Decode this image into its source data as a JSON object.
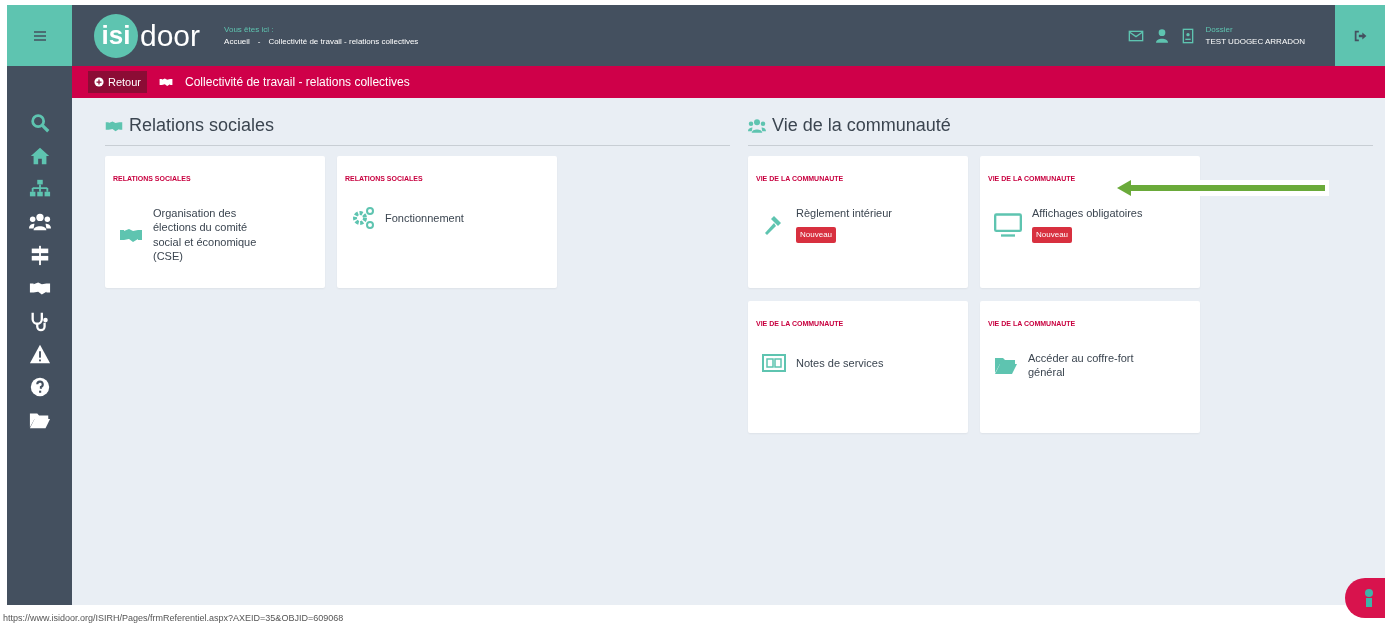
{
  "header": {
    "logo_badge": "isi",
    "logo_text": "door",
    "breadcrumb_label": "Vous êtes ici :",
    "breadcrumb": [
      "Accueil",
      "Collectivité de travail - relations collectives"
    ],
    "breadcrumb_separator": "-",
    "user_label": "Dossier",
    "user_name": "TEST UDOGEC ARRADON"
  },
  "subbar": {
    "back": "Retour",
    "title": "Collectivité de travail - relations collectives"
  },
  "sections": [
    {
      "title": "Relations sociales",
      "cards": [
        {
          "category": "RELATIONS SOCIALES",
          "title": "Organisation des élections du comité social et économique (CSE)"
        },
        {
          "category": "RELATIONS SOCIALES",
          "title": "Fonctionnement"
        }
      ]
    },
    {
      "title": "Vie de la communauté",
      "cards": [
        {
          "category": "VIE DE LA COMMUNAUTE",
          "title": "Règlement intérieur",
          "badge": "Nouveau"
        },
        {
          "category": "VIE DE LA COMMUNAUTE",
          "title": "Affichages obligatoires",
          "badge": "Nouveau"
        },
        {
          "category": "VIE DE LA COMMUNAUTE",
          "title": "Notes de services"
        },
        {
          "category": "VIE DE LA COMMUNAUTE",
          "title": "Accéder au coffre-fort général"
        }
      ]
    }
  ],
  "status_url": "https://www.isidoor.org/ISIRH/Pages/frmReferentiel.aspx?AXEID=35&OBJID=609068"
}
